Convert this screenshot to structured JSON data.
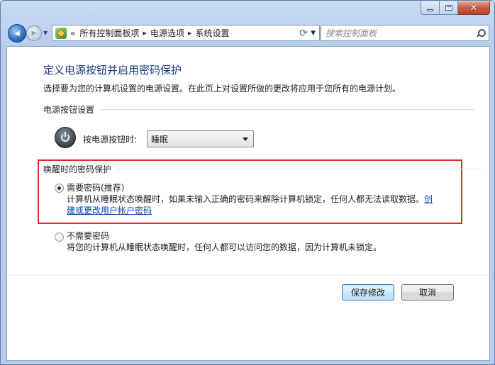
{
  "window": {
    "close_glyph": "✕"
  },
  "nav": {
    "back_glyph": "◀",
    "forward_glyph": "▶",
    "breadcrumb_prefix": "«",
    "breadcrumbs": [
      "所有控制面板项",
      "电源选项",
      "系统设置"
    ],
    "separator": "▸",
    "refresh_glyph": "⟳",
    "search_placeholder": "搜索控制面板"
  },
  "page": {
    "title": "定义电源按钮并启用密码保护",
    "description": "选择要为您的计算机设置的电源设置。在此页上对设置所做的更改将应用于您所有的电源计划。"
  },
  "power_button_section": {
    "heading": "电源按钮设置",
    "press_label": "按电源按钮时:",
    "selected_option": "睡眠"
  },
  "wake_password_section": {
    "heading": "唤醒时的密码保护",
    "require_password": {
      "label": "需要密码(推荐)",
      "description": "计算机从睡眠状态唤醒时，如果未输入正确的密码来解除计算机锁定，任何人都无法读取数据。",
      "link_part1": "创",
      "link_part2": "建或更改用户帐户密码",
      "selected": true
    },
    "no_password": {
      "label": "不需要密码",
      "description": "将您的计算机从睡眠状态唤醒时，任何人都可以访问您的数据，因为计算机未锁定。",
      "selected": false
    }
  },
  "buttons": {
    "save": "保存修改",
    "cancel": "取消"
  },
  "colors": {
    "title_blue": "#1e3a86",
    "link_blue": "#0645ad",
    "highlight_red": "#e12b2b"
  }
}
